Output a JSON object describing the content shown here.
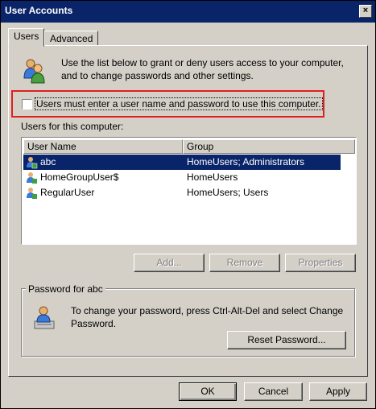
{
  "window": {
    "title": "User Accounts",
    "close_glyph": "×"
  },
  "tabs": [
    {
      "label": "Users",
      "active": true
    },
    {
      "label": "Advanced",
      "active": false
    }
  ],
  "intro": {
    "icon": "users-icon",
    "text": "Use the list below to grant or deny users access to your computer, and to change passwords and other settings."
  },
  "require_login": {
    "label": "Users must enter a user name and password to use this computer.",
    "checked": false
  },
  "users_list": {
    "caption": "Users for this computer:",
    "columns": [
      "User Name",
      "Group"
    ],
    "rows": [
      {
        "name": "abc",
        "group": "HomeUsers; Administrators",
        "selected": true
      },
      {
        "name": "HomeGroupUser$",
        "group": "HomeUsers",
        "selected": false
      },
      {
        "name": "RegularUser",
        "group": "HomeUsers; Users",
        "selected": false
      }
    ]
  },
  "list_buttons": {
    "add": "Add...",
    "remove": "Remove",
    "properties": "Properties"
  },
  "password_group": {
    "title": "Password for abc",
    "icon": "keyboard-user-icon",
    "text": "To change your password, press Ctrl-Alt-Del and select Change Password.",
    "reset_button": "Reset Password..."
  },
  "dialog_buttons": {
    "ok": "OK",
    "cancel": "Cancel",
    "apply": "Apply"
  },
  "colors": {
    "highlight_box": "#e02020",
    "selection": "#0a246a",
    "face": "#d4d0c8"
  }
}
